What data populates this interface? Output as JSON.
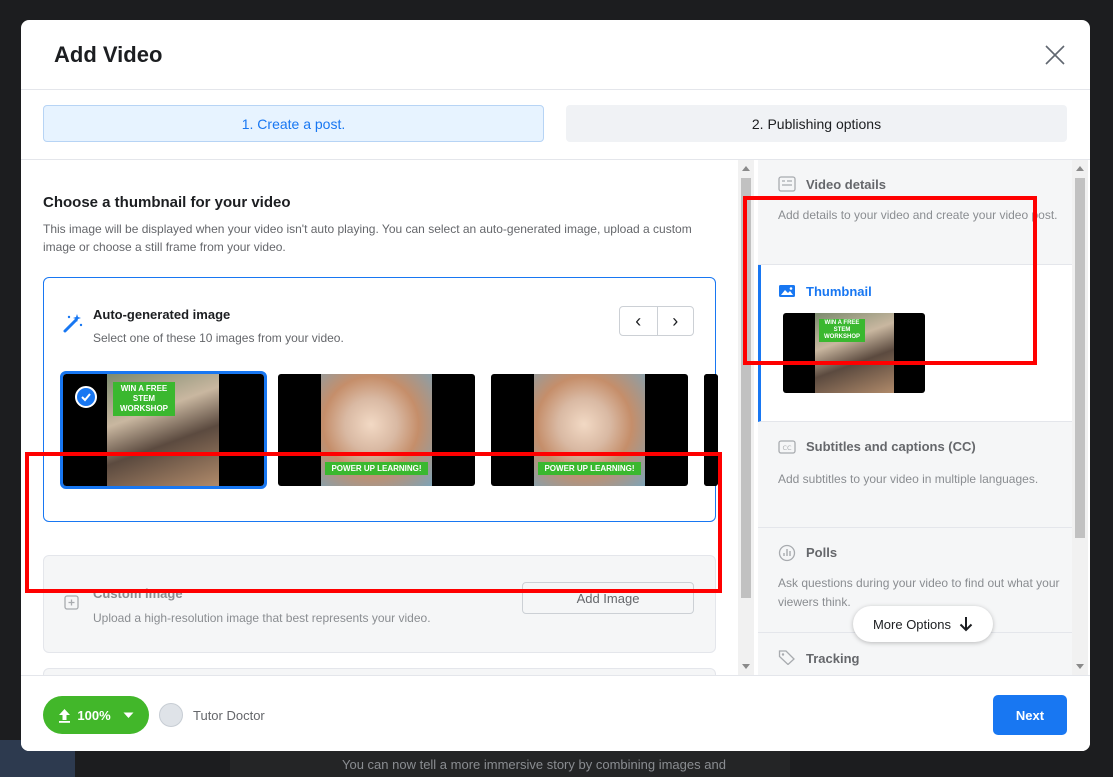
{
  "background": {
    "caption": "You can now tell a more immersive story by combining images and"
  },
  "modal": {
    "title": "Add Video",
    "close_icon": "close-icon"
  },
  "steps": [
    {
      "label": "1. Create a post.",
      "active": true
    },
    {
      "label": "2. Publishing options",
      "active": false
    }
  ],
  "thumbnail_section": {
    "title": "Choose a thumbnail for your video",
    "description": "This image will be displayed when your video isn't auto playing. You can select an auto-generated image, upload a custom image or choose a still frame from your video.",
    "auto": {
      "icon": "magic-wand-icon",
      "title": "Auto-generated image",
      "description": "Select one of these 10 images from your video.",
      "prev_label": "‹",
      "next_label": "›",
      "thumbnails": [
        {
          "tag": "WIN A FREE STEM WORKSHOP",
          "selected": true
        },
        {
          "tag": "POWER UP LEARNING!",
          "selected": false
        },
        {
          "tag": "POWER UP LEARNING!",
          "selected": false
        }
      ]
    },
    "custom": {
      "icon": "add-image-icon",
      "title": "Custom image",
      "description": "Upload a high-resolution image that best represents your video.",
      "button_label": "Add Image"
    }
  },
  "right_panel": {
    "items": [
      {
        "icon": "details-icon",
        "title": "Video details",
        "description": "Add details to your video and create your video post."
      },
      {
        "icon": "image-icon",
        "title": "Thumbnail",
        "active": true,
        "tag": "WIN A FREE STEM WORKSHOP"
      },
      {
        "icon": "cc-icon",
        "title": "Subtitles and captions (CC)",
        "description": "Add subtitles to your video in multiple languages."
      },
      {
        "icon": "poll-icon",
        "title": "Polls",
        "description": "Ask questions during your video to find out what your viewers think."
      },
      {
        "icon": "tag-icon",
        "title": "Tracking"
      }
    ],
    "more_options_label": "More Options"
  },
  "footer": {
    "upload_progress": "100%",
    "page_name": "Tutor Doctor",
    "next_label": "Next"
  },
  "colors": {
    "accent": "#1877f2",
    "upload_green": "#42b72a",
    "annotation_red": "#ff0000"
  }
}
